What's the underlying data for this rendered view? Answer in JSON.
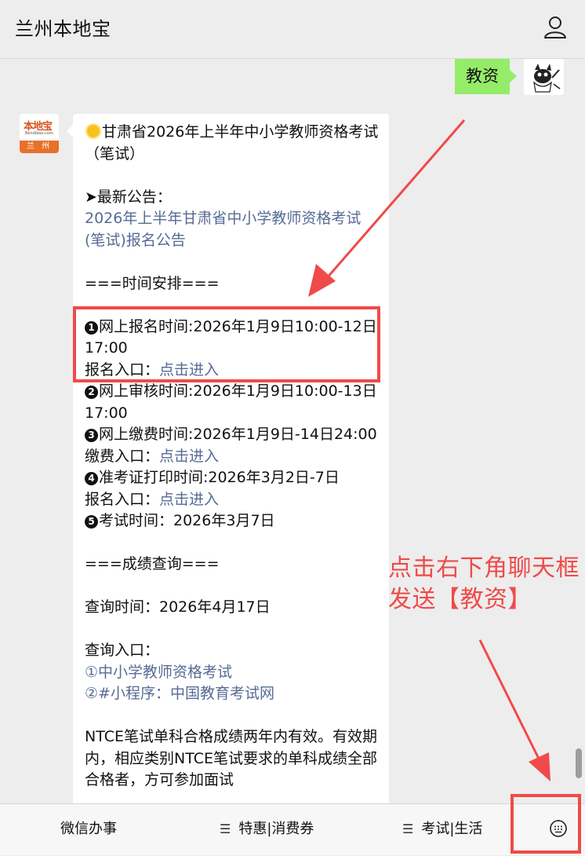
{
  "header": {
    "title": "兰州本地宝",
    "user_icon": "user-icon"
  },
  "chat": {
    "outgoing": {
      "text": "教资",
      "bubble_color": "#95ec69"
    },
    "bot_avatar": {
      "brand": "本地宝",
      "site": "Bendibao.com",
      "city": "兰 州"
    },
    "message": {
      "title": "甘肃省2026年上半年中小学教师资格考试（笔试）",
      "latest_label": "➤最新公告：",
      "latest_link": "2026年上半年甘肃省中小学教师资格考试(笔试)报名公告",
      "schedule_heading": "===时间安排===",
      "items": [
        {
          "num": "1",
          "text": "网上报名时间:2026年1月9日10:00-12日17:00",
          "entry_label": "报名入口：",
          "entry_link": "点击进入"
        },
        {
          "num": "2",
          "text": "网上审核时间:2026年1月9日10:00-13日17:00"
        },
        {
          "num": "3",
          "text": "网上缴费时间:2026年1月9日-14日24:00",
          "entry_label": "缴费入口：",
          "entry_link": "点击进入"
        },
        {
          "num": "4",
          "text": "准考证打印时间:2026年3月2日-7日",
          "entry_label": "报名入口：",
          "entry_link": "点击进入"
        },
        {
          "num": "5",
          "text": "考试时间：2026年3月7日"
        }
      ],
      "score_heading": "===成绩查询===",
      "query_time": "查询时间：2026年4月17日",
      "query_entry_label": "查询入口：",
      "query_links": [
        "①中小学教师资格考试",
        "②#小程序：中国教育考试网"
      ],
      "note": "NTCE笔试单科合格成绩两年内有效。有效期内，相应类别NTCE笔试要求的单科成绩全部合格者，方可参加面试"
    }
  },
  "annotation": {
    "text_line1": "点击右下角聊天框",
    "text_line2": "发送【教资】",
    "color": "#f04a4a"
  },
  "bottom_menu": {
    "items": [
      {
        "label": "微信办事",
        "has_menu_icon": false
      },
      {
        "label": "特惠|消费券",
        "has_menu_icon": true
      },
      {
        "label": "考试|生活",
        "has_menu_icon": true
      }
    ],
    "keyboard_icon": "keyboard-icon"
  },
  "colors": {
    "link": "#576b95",
    "background": "#ededed"
  }
}
